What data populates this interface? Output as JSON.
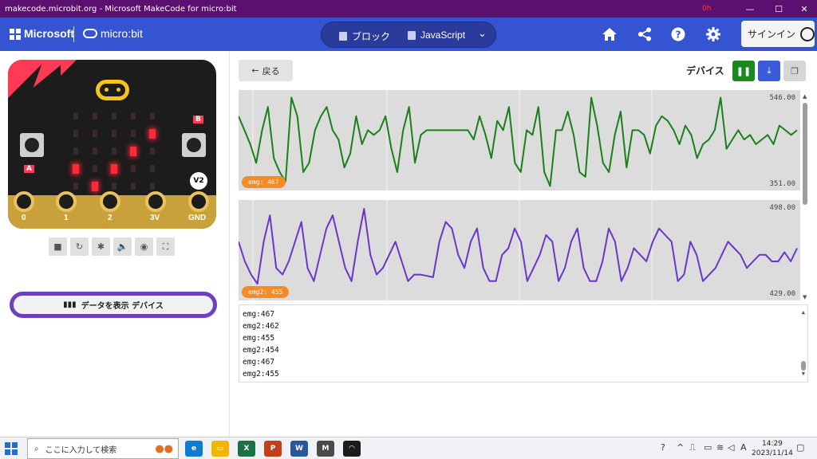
{
  "window": {
    "title": "makecode.microbit.org - Microsoft MakeCode for micro:bit",
    "record_badge": "0h",
    "controls": {
      "minimize": "—",
      "maximize": "☐",
      "close": "✕"
    }
  },
  "header": {
    "brand": "Microsoft",
    "product": "micro:bit",
    "tabs": [
      {
        "label": "ブロック",
        "icon": "blocks-icon"
      },
      {
        "label": "JavaScript",
        "icon": "js-icon"
      }
    ],
    "signin_label": "サインイン",
    "icons": [
      "home-icon",
      "share-icon",
      "help-icon",
      "gear-icon"
    ]
  },
  "simulator": {
    "pin_labels": [
      "0",
      "1",
      "2",
      "3V",
      "GND"
    ],
    "button_a": "A",
    "button_b": "B",
    "version_badge": "V2",
    "led_grid": [
      [
        0,
        0,
        0,
        0,
        0
      ],
      [
        0,
        0,
        0,
        0,
        1
      ],
      [
        0,
        0,
        0,
        1,
        0
      ],
      [
        1,
        0,
        1,
        0,
        0
      ],
      [
        0,
        1,
        0,
        0,
        0
      ]
    ],
    "show_data_label": "データを表示 デバイス"
  },
  "data_view": {
    "back_label": "戻る",
    "title": "デバイス",
    "colors": {
      "pause": "#1a8a20",
      "download": "#3b5bdb",
      "copy": "#d6d6d6",
      "series1": "#1a7f1a",
      "series2": "#6a35c9",
      "tag": "#f58a27"
    },
    "charts": [
      {
        "tag": "emg: 467",
        "ymax": "546.00",
        "ymin": "351.00"
      },
      {
        "tag": "emg2: 455",
        "ymax": "498.00",
        "ymin": "429.00"
      }
    ],
    "console_lines": [
      "emg:467",
      "emg2:462",
      "emg:455",
      "emg2:454",
      "emg:467",
      "emg2:455"
    ]
  },
  "chart_data": [
    {
      "type": "line",
      "title": "",
      "series": [
        {
          "name": "emg",
          "values": [
            500,
            470,
            440,
            400,
            470,
            520,
            410,
            380,
            360,
            540,
            500,
            380,
            400,
            470,
            500,
            520,
            470,
            450,
            390,
            420,
            500,
            440,
            470,
            460,
            470,
            500,
            430,
            380,
            470,
            520,
            400,
            460,
            470,
            470,
            470,
            470,
            470,
            470,
            470,
            470,
            450,
            500,
            460,
            410,
            490,
            470,
            520,
            400,
            380,
            470,
            460,
            520,
            380,
            350,
            470,
            470,
            510,
            460,
            380,
            370,
            540,
            480,
            400,
            380,
            460,
            510,
            390,
            470,
            470,
            460,
            420,
            480,
            500,
            490,
            470,
            440,
            480,
            460,
            410,
            440,
            450,
            470,
            540,
            430,
            450,
            470,
            450,
            460,
            440,
            450,
            460,
            440,
            480,
            470,
            460,
            470
          ]
        }
      ],
      "ylim": [
        351,
        546
      ]
    },
    {
      "type": "line",
      "title": "",
      "series": [
        {
          "name": "emg2",
          "values": [
            470,
            455,
            445,
            438,
            470,
            490,
            450,
            445,
            455,
            470,
            485,
            450,
            440,
            460,
            480,
            490,
            470,
            450,
            440,
            470,
            495,
            460,
            445,
            450,
            460,
            470,
            455,
            440,
            445,
            445,
            444,
            443,
            470,
            485,
            480,
            460,
            450,
            470,
            480,
            450,
            440,
            440,
            460,
            465,
            480,
            470,
            440,
            450,
            460,
            475,
            470,
            440,
            450,
            470,
            480,
            450,
            440,
            440,
            455,
            480,
            470,
            440,
            450,
            465,
            460,
            455,
            470,
            480,
            475,
            470,
            440,
            445,
            470,
            460,
            440,
            445,
            450,
            460,
            470,
            465,
            460,
            450,
            455,
            460,
            460,
            455,
            455,
            462,
            455,
            465
          ]
        }
      ],
      "ylim": [
        429,
        498
      ]
    }
  ]
}
